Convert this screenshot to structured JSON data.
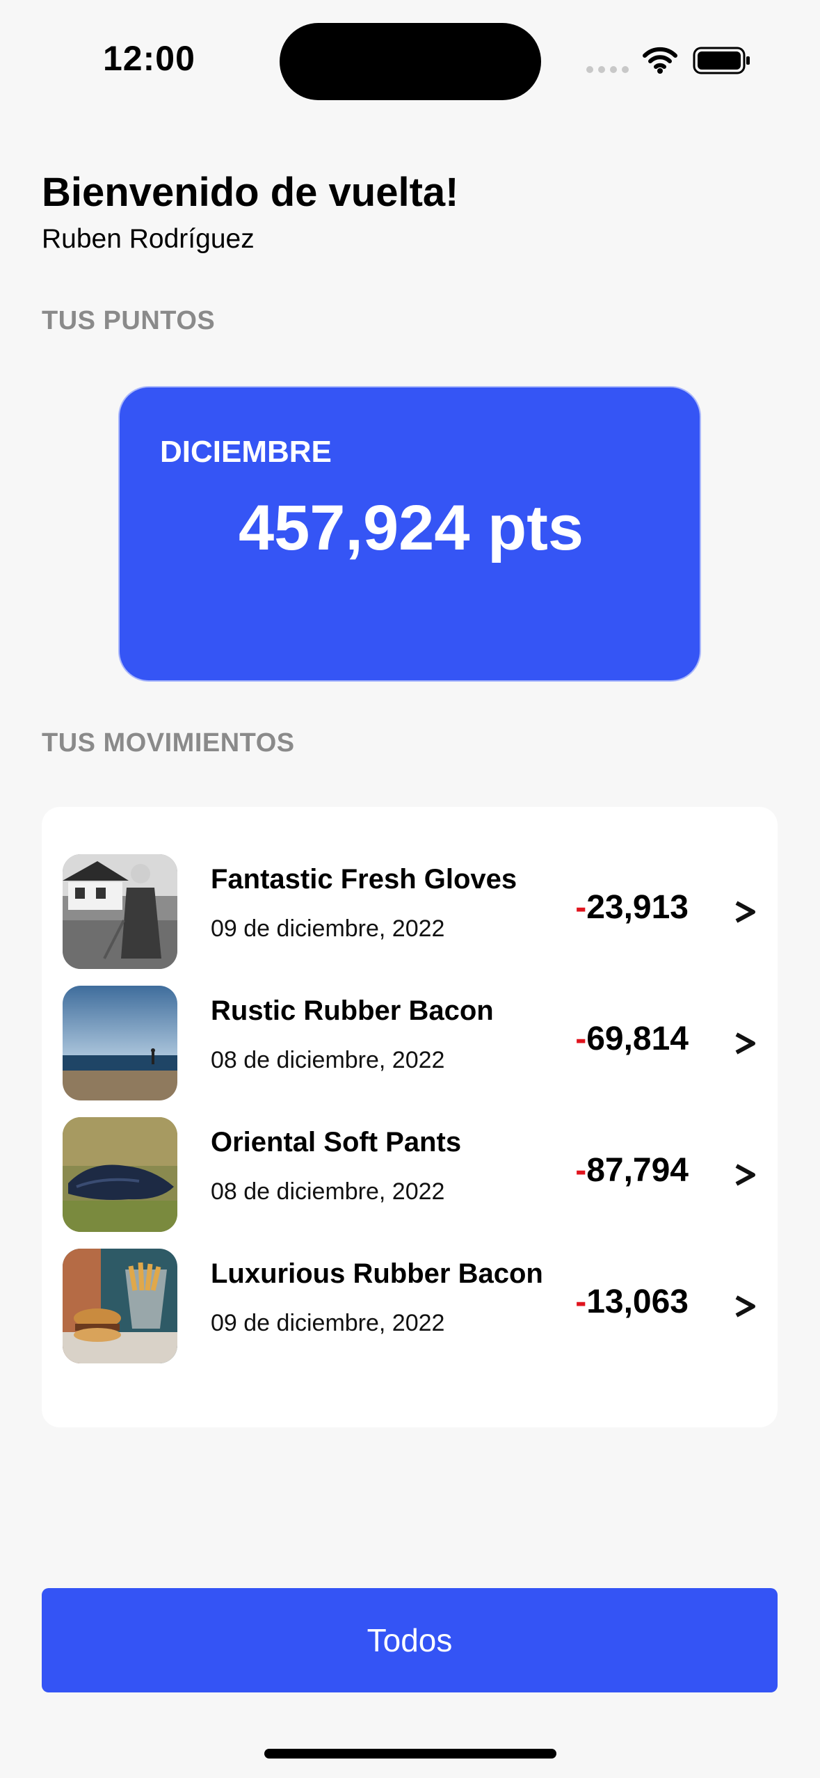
{
  "status_bar": {
    "time": "12:00",
    "icons": [
      "signal-dots-icon",
      "wifi-icon",
      "battery-icon"
    ]
  },
  "header": {
    "welcome": "Bienvenido de vuelta!",
    "user_name": "Ruben Rodríguez"
  },
  "points_section": {
    "label": "TUS PUNTOS",
    "month": "DICIEMBRE",
    "value": "457,924 pts"
  },
  "movements_section": {
    "label": "TUS MOVIMIENTOS",
    "items": [
      {
        "title": "Fantastic Fresh Gloves",
        "date": "09 de diciembre, 2022",
        "sign": "-",
        "amount": "23,913",
        "chevron": ">"
      },
      {
        "title": "Rustic Rubber Bacon",
        "date": "08 de diciembre, 2022",
        "sign": "-",
        "amount": "69,814",
        "chevron": ">"
      },
      {
        "title": "Oriental Soft Pants",
        "date": "08 de diciembre, 2022",
        "sign": "-",
        "amount": "87,794",
        "chevron": ">"
      },
      {
        "title": "Luxurious Rubber Bacon",
        "date": "09 de diciembre, 2022",
        "sign": "-",
        "amount": "13,063",
        "chevron": ">"
      }
    ]
  },
  "footer": {
    "button_label": "Todos"
  },
  "colors": {
    "accent": "#3555f5",
    "negative": "#e0141e",
    "background": "#f7f7f7",
    "muted_label": "#8a8a8a"
  }
}
